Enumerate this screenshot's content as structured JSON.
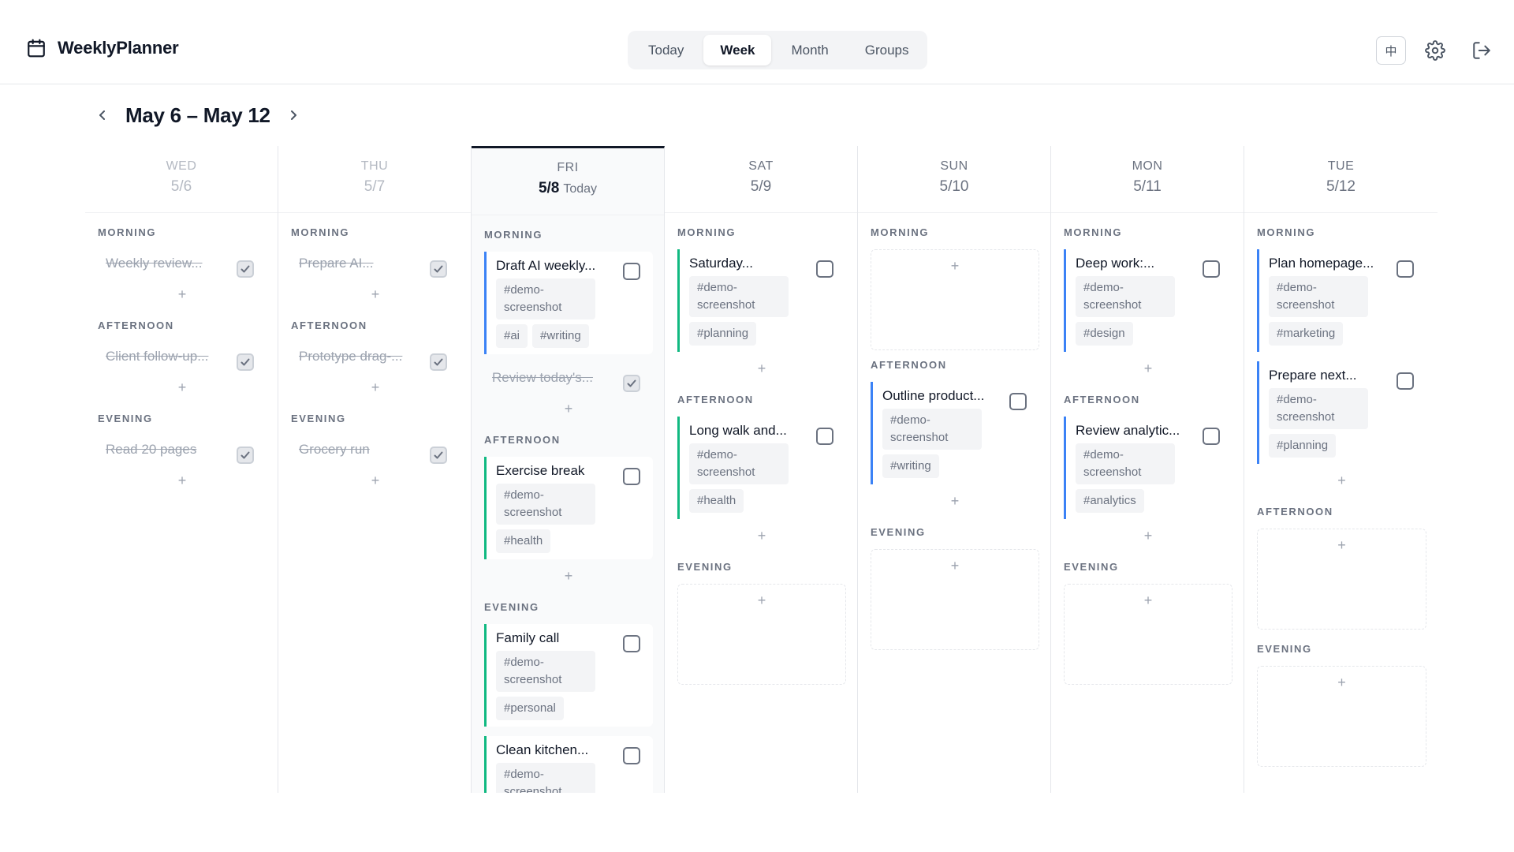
{
  "app": {
    "name": "WeeklyPlanner"
  },
  "view_tabs": [
    "Today",
    "Week",
    "Month",
    "Groups"
  ],
  "active_view": "Week",
  "header": {
    "language_button": "中"
  },
  "week_nav": {
    "title": "May 6 – May 12"
  },
  "today_label": "Today",
  "days": [
    {
      "name": "WED",
      "date": "5/6",
      "periods": [
        {
          "label": "MORNING",
          "tasks": [
            {
              "title": "Weekly review...",
              "done": true
            }
          ]
        },
        {
          "label": "AFTERNOON",
          "tasks": [
            {
              "title": "Client follow-up...",
              "done": true
            }
          ]
        },
        {
          "label": "EVENING",
          "tasks": [
            {
              "title": "Read 20 pages",
              "done": true
            }
          ]
        }
      ]
    },
    {
      "name": "THU",
      "date": "5/7",
      "periods": [
        {
          "label": "MORNING",
          "tasks": [
            {
              "title": "Prepare AI...",
              "done": true
            }
          ]
        },
        {
          "label": "AFTERNOON",
          "tasks": [
            {
              "title": "Prototype drag-...",
              "done": true
            }
          ]
        },
        {
          "label": "EVENING",
          "tasks": [
            {
              "title": "Grocery run",
              "done": true
            }
          ]
        }
      ]
    },
    {
      "name": "FRI",
      "date": "5/8",
      "periods": [
        {
          "label": "MORNING",
          "tasks": [
            {
              "title": "Draft AI weekly...",
              "done": false,
              "color": "blue",
              "tags": [
                "#demo-screenshot",
                "#ai",
                "#writing"
              ]
            },
            {
              "title": "Review today's...",
              "done": true
            }
          ]
        },
        {
          "label": "AFTERNOON",
          "tasks": [
            {
              "title": "Exercise break",
              "done": false,
              "color": "green",
              "tags": [
                "#demo-screenshot",
                "#health"
              ]
            }
          ]
        },
        {
          "label": "EVENING",
          "tasks": [
            {
              "title": "Family call",
              "done": false,
              "color": "green",
              "tags": [
                "#demo-screenshot",
                "#personal"
              ]
            },
            {
              "title": "Clean kitchen...",
              "done": false,
              "color": "green",
              "tags": [
                "#demo-screenshot"
              ]
            }
          ]
        }
      ]
    },
    {
      "name": "SAT",
      "date": "5/9",
      "periods": [
        {
          "label": "MORNING",
          "tasks": [
            {
              "title": "Saturday...",
              "done": false,
              "color": "green",
              "tags": [
                "#demo-screenshot",
                "#planning"
              ]
            }
          ]
        },
        {
          "label": "AFTERNOON",
          "tasks": [
            {
              "title": "Long walk and...",
              "done": false,
              "color": "green",
              "tags": [
                "#demo-screenshot",
                "#health"
              ]
            }
          ]
        },
        {
          "label": "EVENING",
          "tasks": []
        }
      ]
    },
    {
      "name": "SUN",
      "date": "5/10",
      "periods": [
        {
          "label": "MORNING",
          "tasks": []
        },
        {
          "label": "AFTERNOON",
          "tasks": [
            {
              "title": "Outline product...",
              "done": false,
              "color": "blue",
              "tags": [
                "#demo-screenshot",
                "#writing"
              ]
            }
          ]
        },
        {
          "label": "EVENING",
          "tasks": []
        }
      ]
    },
    {
      "name": "MON",
      "date": "5/11",
      "periods": [
        {
          "label": "MORNING",
          "tasks": [
            {
              "title": "Deep work:...",
              "done": false,
              "color": "blue",
              "tags": [
                "#demo-screenshot",
                "#design"
              ]
            }
          ]
        },
        {
          "label": "AFTERNOON",
          "tasks": [
            {
              "title": "Review analytic...",
              "done": false,
              "color": "blue",
              "tags": [
                "#demo-screenshot",
                "#analytics"
              ]
            }
          ]
        },
        {
          "label": "EVENING",
          "tasks": []
        }
      ]
    },
    {
      "name": "TUE",
      "date": "5/12",
      "periods": [
        {
          "label": "MORNING",
          "tasks": [
            {
              "title": "Plan homepage...",
              "done": false,
              "color": "blue",
              "tags": [
                "#demo-screenshot",
                "#marketing"
              ]
            },
            {
              "title": "Prepare next...",
              "done": false,
              "color": "blue",
              "tags": [
                "#demo-screenshot",
                "#planning"
              ]
            }
          ]
        },
        {
          "label": "AFTERNOON",
          "tasks": []
        },
        {
          "label": "EVENING",
          "tasks": []
        }
      ]
    }
  ],
  "today_index": 2,
  "past_indices": [
    0,
    1
  ],
  "add_symbol": "+",
  "colors": {
    "blue": "#3b82f6",
    "green": "#10b981",
    "text": "#111827",
    "muted": "#6b7280"
  }
}
